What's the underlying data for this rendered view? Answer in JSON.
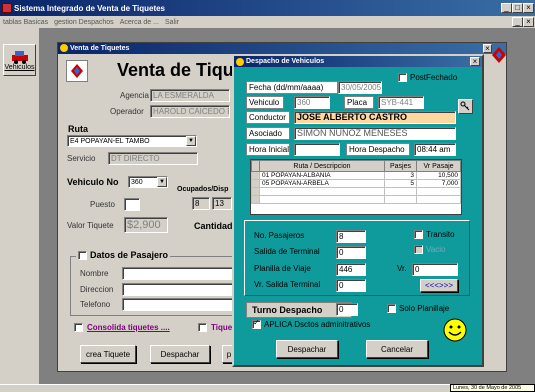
{
  "app": {
    "title": "Sistema Integrado de Venta de Tiquetes",
    "menu": [
      "tablas Basicas",
      "gestion Despachos",
      "Acerca de ...",
      "Salir"
    ]
  },
  "sidebar": {
    "vehiculos_label": "Vehiculos"
  },
  "venta": {
    "window_title": "Venta de Tiquetes",
    "heading": "Venta de Tiquet",
    "agencia_label": "Agencia",
    "agencia_value": "LA ESMERALDA",
    "operador_label": "Operador",
    "operador_value": "HAROLD CAICEDO R",
    "ruta_label": "Ruta",
    "ruta_value": "E4 POPAYAN-EL TAMBO",
    "servicio_label": "Servicio",
    "servicio_value": "DT DIRECTO",
    "vehiculo_label": "Vehiculo No",
    "vehiculo_value": "360",
    "ocupados_label": "Ocupados/Disp",
    "ocupados_value": "8",
    "disponibles_value": "13",
    "puesto_label": "Puesto",
    "valor_label": "Valor Tiquete",
    "valor_value": "$2,900",
    "cantidad_label": "Cantidad",
    "datos_pasajero_label": "Datos de Pasajero",
    "nombre_label": "Nombre",
    "direccion_label": "Direccion",
    "telefono_label": "Telefono",
    "consolida_label": "Consolida tiquetes ....",
    "tiquete_chk_label": "Tique",
    "crea_tiquete_btn": "crea Tiquete",
    "despachar_btn": "Despachar",
    "p_btn": "p"
  },
  "despacho": {
    "window_title": "Despacho de Vehiculos",
    "fecha_label": "Fecha (dd/mm/aaaa)",
    "fecha_value": "30/05/2005",
    "postfechado_label": "PostFechado",
    "vehiculo_label": "Vehiculo",
    "vehiculo_value": "360",
    "placa_label": "Placa",
    "placa_value": "SYB-441",
    "conductor_label": "Conductor",
    "conductor_value": "JOSE ALBERTO CASTRO",
    "asociado_label": "Asociado",
    "asociado_value": "SIMON NUÑOZ MENESES",
    "hora_inicial_label": "Hora Inicial",
    "hora_inicial_value": "",
    "hora_despacho_label": "Hora Despacho",
    "hora_despacho_value": "08:44 am",
    "table": {
      "headers": [
        "Ruta / Descripcion",
        "Pasjes",
        "Vr Pasaje"
      ],
      "rows": [
        [
          "01 POPAYAN-ALBANIA",
          "3",
          "10,500"
        ],
        [
          "05 POPAYAN-ARBELA",
          "5",
          "7,000"
        ]
      ]
    },
    "no_pasajeros_label": "No. Pasajeros",
    "no_pasajeros_value": "8",
    "transito_label": "Transito",
    "vacio_label": "Vacio",
    "salida_terminal_label": "Salida de Terminal",
    "salida_terminal_value": "0",
    "planilla_label": "Planilla de Viaje",
    "planilla_value": "446",
    "vr_label": "Vr.",
    "vr_value": "0",
    "vr_salida_label": "Vr. Salida Terminal",
    "vr_salida_value": "0",
    "nav_btn": "<<<>>>",
    "turno_label": "Turno Despacho",
    "turno_value": "0",
    "solo_planillaje_label": "Solo Planillaje",
    "aplica_label": "APLICA Dsctos adminitrativos",
    "despachar_btn": "Despachar",
    "cancelar_btn": "Cancelar"
  },
  "statusbar": {
    "date_text": "Lunes, 30 de Mayo de 2005"
  },
  "colors": {
    "teal": "#0f9b9b",
    "highlight_orange": "#ffd7a0",
    "title_blue": "#0a246a",
    "gray_face": "#d4d0c8"
  },
  "icons": [
    "car-icon",
    "ticket-logo-icon",
    "key-icon",
    "smiley-icon",
    "chevron-down-icon"
  ]
}
